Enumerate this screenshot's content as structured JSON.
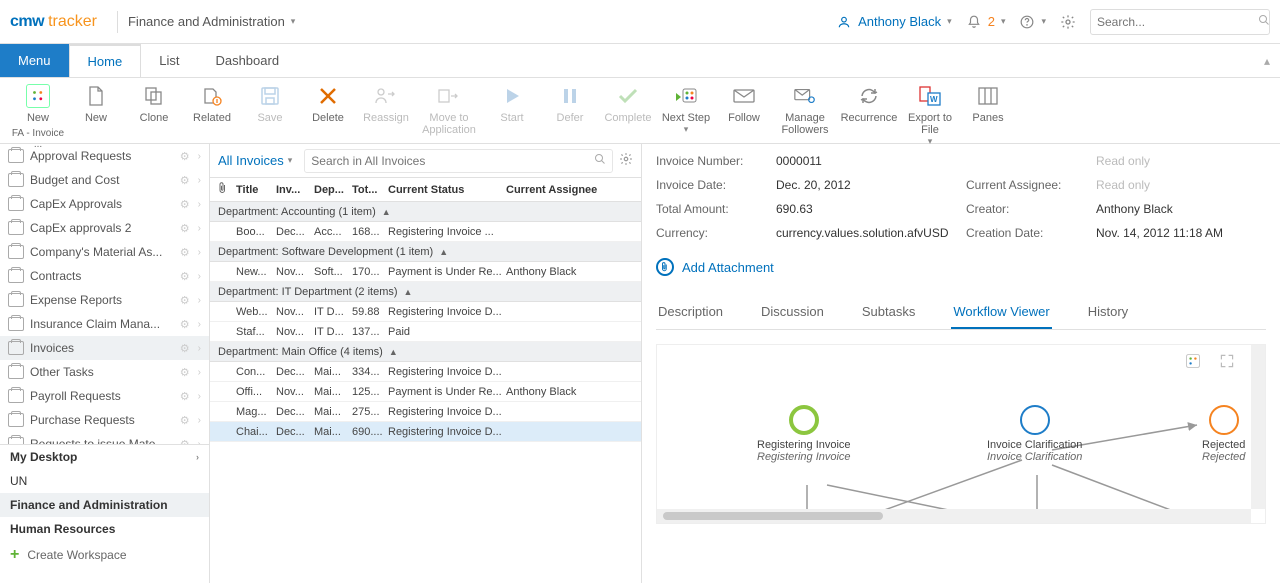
{
  "header": {
    "logo_cmw": "cmw",
    "logo_tracker": "tracker",
    "breadcrumb": "Finance and Administration",
    "user": "Anthony Black",
    "notif_count": "2",
    "search_placeholder": "Search..."
  },
  "menubar": {
    "menu": "Menu",
    "home": "Home",
    "list": "List",
    "dashboard": "Dashboard"
  },
  "toolbar": {
    "new_fa": "New",
    "new_fa_sub": "FA - Invoice ...",
    "new": "New",
    "clone": "Clone",
    "related": "Related",
    "save": "Save",
    "delete": "Delete",
    "reassign": "Reassign",
    "move": "Move to Application",
    "start": "Start",
    "defer": "Defer",
    "complete": "Complete",
    "next_step": "Next Step",
    "follow": "Follow",
    "manage_followers": "Manage Followers",
    "recurrence": "Recurrence",
    "export": "Export to File",
    "panes": "Panes"
  },
  "sidebar": {
    "items": [
      "Approval Requests",
      "Budget and Cost",
      "CapEx Approvals",
      "CapEx approvals 2",
      "Company's Material As...",
      "Contracts",
      "Expense Reports",
      "Insurance Claim Mana...",
      "Invoices",
      "Other Tasks",
      "Payroll Requests",
      "Purchase Requests",
      "Requests to issue Mate..."
    ],
    "workspaces": {
      "my_desktop": "My Desktop",
      "un": "UN",
      "finance": "Finance and Administration",
      "hr": "Human Resources"
    },
    "create": "Create Workspace"
  },
  "list": {
    "view": "All Invoices",
    "search_placeholder": "Search in All Invoices",
    "headers": {
      "title": "Title",
      "inv": "Inv...",
      "dep": "Dep...",
      "tot": "Tot...",
      "status": "Current Status",
      "assignee": "Current Assignee"
    },
    "groups": [
      {
        "label": "Department: Accounting (1 item)",
        "rows": [
          {
            "title": "Boo...",
            "inv": "Dec...",
            "dep": "Acc...",
            "tot": "168...",
            "status": "Registering Invoice ...",
            "assignee": ""
          }
        ]
      },
      {
        "label": "Department: Software Development (1 item)",
        "rows": [
          {
            "title": "New...",
            "inv": "Nov...",
            "dep": "Soft...",
            "tot": "170...",
            "status": "Payment is Under Re...",
            "assignee": "Anthony Black"
          }
        ]
      },
      {
        "label": "Department: IT Department (2 items)",
        "rows": [
          {
            "title": "Web...",
            "inv": "Nov...",
            "dep": "IT D...",
            "tot": "59.88",
            "status": "Registering Invoice D...",
            "assignee": ""
          },
          {
            "title": "Staf...",
            "inv": "Nov...",
            "dep": "IT D...",
            "tot": "137...",
            "status": "Paid",
            "assignee": ""
          }
        ]
      },
      {
        "label": "Department: Main Office (4 items)",
        "rows": [
          {
            "title": "Con...",
            "inv": "Dec...",
            "dep": "Mai...",
            "tot": "334...",
            "status": "Registering Invoice D...",
            "assignee": ""
          },
          {
            "title": "Offi...",
            "inv": "Nov...",
            "dep": "Mai...",
            "tot": "125...",
            "status": "Payment is Under Re...",
            "assignee": "Anthony Black"
          },
          {
            "title": "Mag...",
            "inv": "Dec...",
            "dep": "Mai...",
            "tot": "275...",
            "status": "Registering Invoice D...",
            "assignee": ""
          },
          {
            "title": "Chai...",
            "inv": "Dec...",
            "dep": "Mai...",
            "tot": "690....",
            "status": "Registering Invoice D...",
            "assignee": ""
          }
        ]
      }
    ]
  },
  "detail": {
    "labels": {
      "invoice_number": "Invoice Number:",
      "invoice_date": "Invoice Date:",
      "total": "Total Amount:",
      "currency": "Currency:",
      "assignee": "Current Assignee:",
      "creator": "Creator:",
      "creation": "Creation Date:"
    },
    "values": {
      "invoice_number": "0000011",
      "invoice_date": "Dec. 20, 2012",
      "total": "690.63",
      "currency": "currency.values.solution.afvUSD",
      "readonly": "Read only",
      "creator": "Anthony Black",
      "creation": "Nov. 14, 2012 11:18 AM"
    },
    "attach": "Add Attachment",
    "tabs": {
      "description": "Description",
      "discussion": "Discussion",
      "subtasks": "Subtasks",
      "workflow": "Workflow Viewer",
      "history": "History"
    },
    "wf": {
      "n1": {
        "title": "Registering Invoice",
        "sub": "Registering Invoice",
        "color": "#8cc63f"
      },
      "n2": {
        "title": "Invoice Clarification",
        "sub": "Invoice Clarification",
        "color": "#1e7dc8"
      },
      "n3": {
        "title": "Rejected",
        "sub": "Rejected",
        "color": "#f58320"
      }
    }
  }
}
